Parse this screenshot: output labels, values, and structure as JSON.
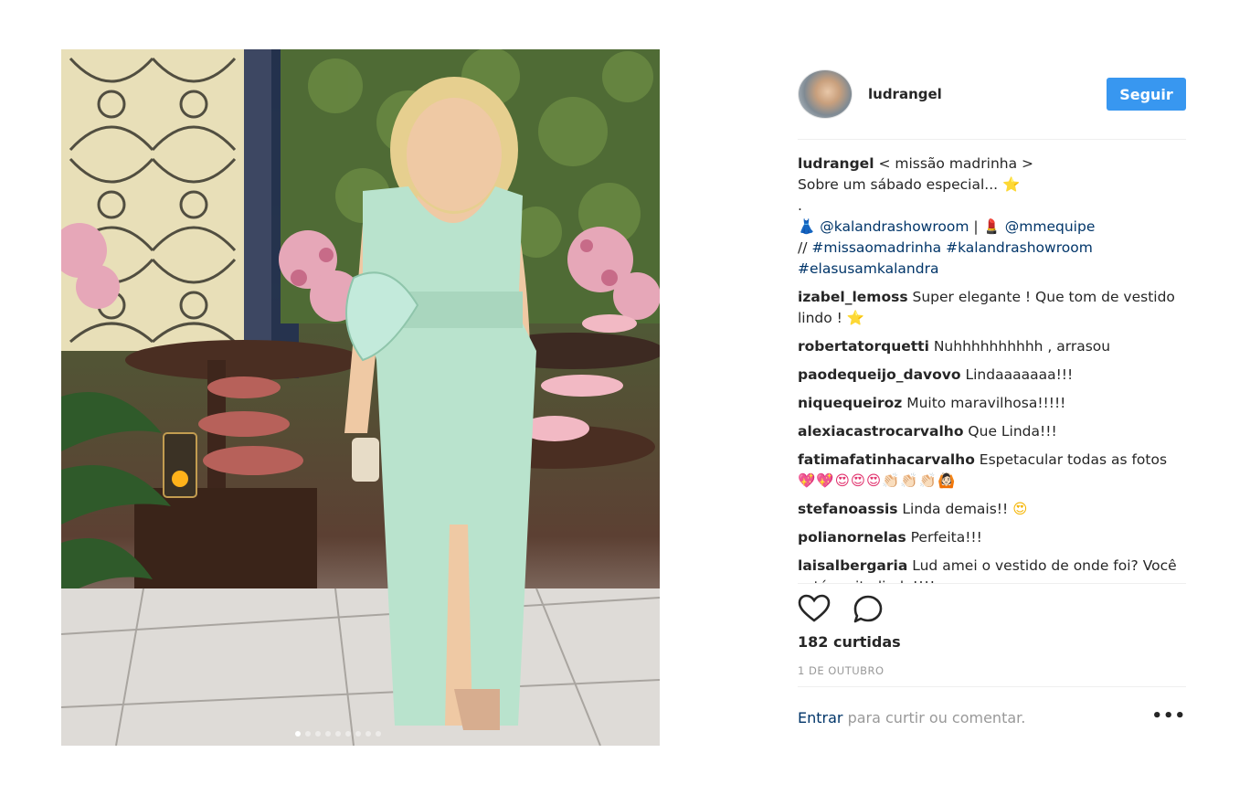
{
  "post": {
    "username": "ludrangel",
    "follow_label": "Seguir",
    "likes": "182 curtidas",
    "date": "1 DE OUTUBRO",
    "carousel_count": 9,
    "carousel_active": 1
  },
  "caption": {
    "username": "ludrangel",
    "line1": "< missão madrinha >",
    "line2": "Sobre um sábado especial... ",
    "line2_emoji": "⭐",
    "line3": ".",
    "dress_emoji": "👗",
    "mention1": "@kalandrashowroom",
    "divider": " | ",
    "lipstick_emoji": "💄",
    "mention2": "@mmequipe",
    "prefix": "// ",
    "hashtag1": "#missaomadrinha",
    "hashtag2": "#kalandrashowroom",
    "hashtag3": "#elasusamkalandra"
  },
  "comments": [
    {
      "user": "izabel_lemoss",
      "text": "Super elegante ! Que tom de vestido lindo ! ",
      "emoji": "⭐"
    },
    {
      "user": "robertatorquetti",
      "text": "Nuhhhhhhhhhh , arrasou",
      "emoji": ""
    },
    {
      "user": "paodequeijo_davovo",
      "text": "Lindaaaaaaa!!!",
      "emoji": ""
    },
    {
      "user": "niquequeiroz",
      "text": "Muito maravilhosa!!!!!",
      "emoji": ""
    },
    {
      "user": "alexiacastrocarvalho",
      "text": "Que Linda!!!",
      "emoji": ""
    },
    {
      "user": "fatimafatinhacarvalho",
      "text": "Espetacular todas as fotos ",
      "emoji": "💖💖😍😍😍👏🏻👏🏻👏🏻🙆🏻"
    },
    {
      "user": "stefanoassis",
      "text": "Linda demais!! ",
      "emoji": "😍"
    },
    {
      "user": "polianornelas",
      "text": "Perfeita!!!",
      "emoji": ""
    },
    {
      "user": "laisalbergaria",
      "text": "Lud amei o vestido de onde foi? Você está muito linda!!!!",
      "emoji": ""
    }
  ],
  "footer": {
    "login_link": "Entrar",
    "login_text": " para curtir ou comentar.",
    "more_label": "•••"
  },
  "icons": {
    "like": "heart-icon",
    "comment": "speech-bubble-icon",
    "more": "more-options-icon"
  },
  "colors": {
    "follow_button": "#3897f0",
    "link": "#003569",
    "muted": "#999999",
    "text": "#262626"
  }
}
